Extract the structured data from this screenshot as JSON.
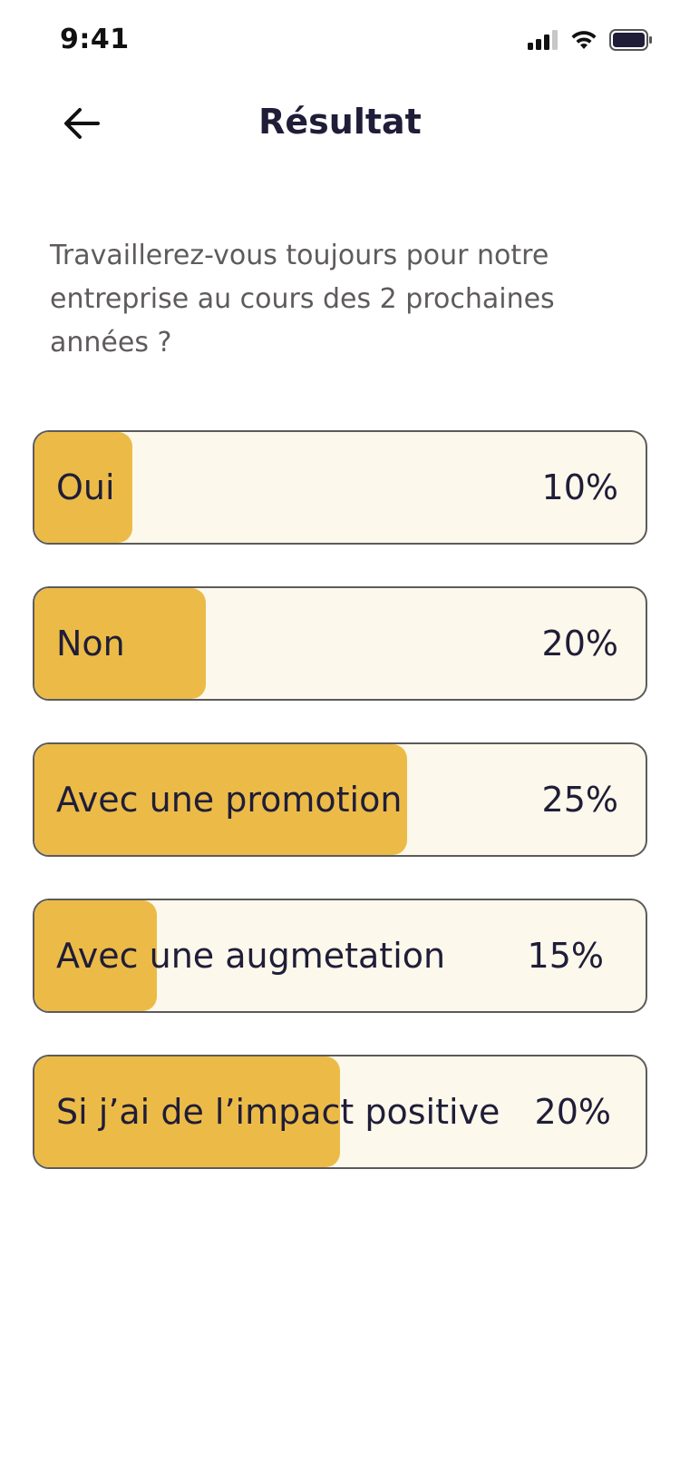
{
  "status_bar": {
    "time": "9:41",
    "icons": [
      "signal-icon",
      "wifi-icon",
      "battery-icon"
    ]
  },
  "header": {
    "title": "Résultat",
    "back_icon": "arrow-left-icon"
  },
  "question": "Travaillerez-vous toujours pour notre entreprise au cours des 2 prochaines années ?",
  "colors": {
    "fill": "#ecbb47",
    "track": "#fcf8eb",
    "border": "#5b5b5b",
    "text": "#1f1d38"
  },
  "options": [
    {
      "label": "Oui",
      "percent_label": "10%",
      "fill_fraction": 0.16
    },
    {
      "label": "Non",
      "percent_label": "20%",
      "fill_fraction": 0.28
    },
    {
      "label": "Avec une promotion",
      "percent_label": "25%",
      "fill_fraction": 0.61
    },
    {
      "label": "Avec une augmetation",
      "percent_label": "15%",
      "fill_fraction": 0.2
    },
    {
      "label": "Si j’ai de l’impact positive",
      "percent_label": "20%",
      "fill_fraction": 0.5
    }
  ]
}
